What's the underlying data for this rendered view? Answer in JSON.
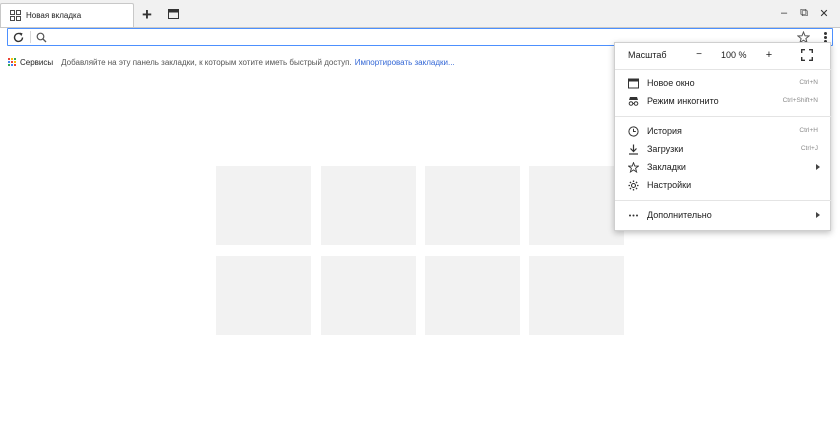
{
  "tab": {
    "title": "Новая вкладка"
  },
  "window": {
    "minimize": "–",
    "restore": "⧉",
    "close": "✕"
  },
  "omnibox": {
    "value": "",
    "placeholder": ""
  },
  "bookmarks": {
    "apps_label": "Сервисы",
    "prompt": "Добавляйте на эту панель закладки, к которым хотите иметь быстрый доступ.",
    "import_link": "Импортировать закладки...",
    "apps_icon_colors": [
      "#ea4335",
      "#fbbc05",
      "#34a853",
      "#4285f4",
      "#ea4335",
      "#fbbc05",
      "#34a853",
      "#4285f4",
      "#ea4335"
    ]
  },
  "speed_dial": {
    "tile_color": "#f2f2f2",
    "rows": 2,
    "columns": 4
  },
  "menu": {
    "zoom": {
      "label": "Масштаб",
      "minus": "−",
      "value": "100 %",
      "plus": "+"
    },
    "items": [
      {
        "label": "Новое окно",
        "shortcut": "Ctrl+N",
        "icon": "new-window-icon"
      },
      {
        "label": "Режим инкогнито",
        "shortcut": "Ctrl+Shift+N",
        "icon": "incognito-icon"
      },
      {
        "label": "История",
        "shortcut": "Ctrl+H",
        "icon": "history-icon"
      },
      {
        "label": "Загрузки",
        "shortcut": "Ctrl+J",
        "icon": "download-icon"
      },
      {
        "label": "Закладки",
        "shortcut": "",
        "icon": "star-icon",
        "submenu": true
      },
      {
        "label": "Настройки",
        "shortcut": "",
        "icon": "gear-icon"
      },
      {
        "label": "Дополнительно",
        "shortcut": "",
        "icon": "more-horizontal-icon",
        "submenu": true
      }
    ]
  },
  "colors": {
    "accent": "#4d90fe",
    "link": "#3367d6",
    "tabstrip": "#f1f1f1"
  }
}
